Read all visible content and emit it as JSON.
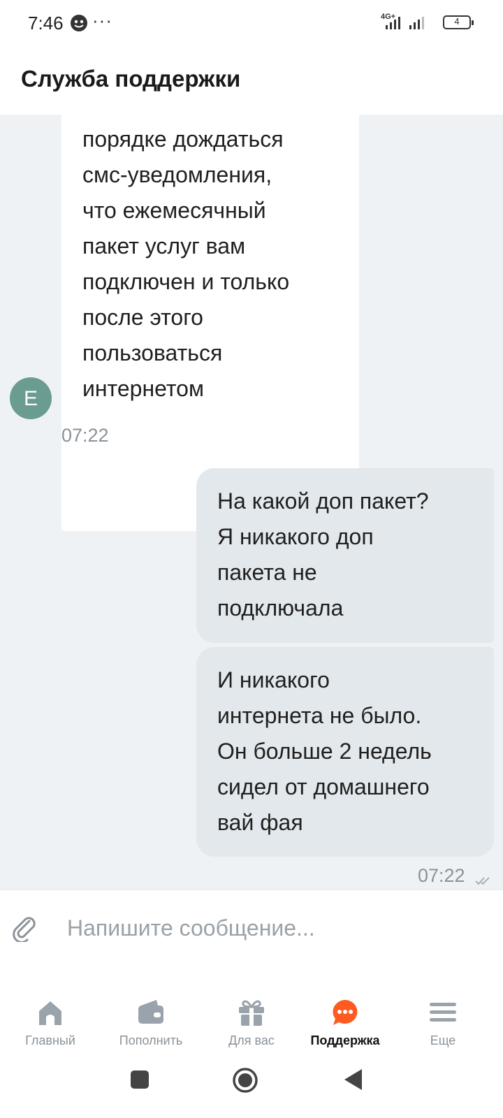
{
  "status_bar": {
    "time": "7:46",
    "overflow": "···",
    "network": "4G+",
    "battery": "4"
  },
  "header": {
    "title": "Служба поддержки"
  },
  "chat": {
    "incoming": {
      "avatar_letter": "E",
      "avatar_color": "#6b9c92",
      "text": "порядке дождаться\nсмс-уведомления,\nчто ежемесячный\nпакет услуг вам\nподключен и только\nпосле этого\nпользоваться\nинтернетом",
      "time": "07:22"
    },
    "outgoing": [
      {
        "text": "На какой доп пакет?\nЯ никакого доп\nпакета не\nподключала"
      },
      {
        "text": "И никакого\nинтернета не было.\nОн больше 2 недель\nсидел от домашнего\nвай фая"
      }
    ],
    "outgoing_time": "07:22",
    "read_status_icon": "double-check-icon"
  },
  "input": {
    "placeholder": "Напишите сообщение..."
  },
  "bottom_nav": {
    "items": [
      {
        "label": "Главный",
        "icon": "home-icon"
      },
      {
        "label": "Пополнить",
        "icon": "wallet-icon"
      },
      {
        "label": "Для вас",
        "icon": "gift-icon"
      },
      {
        "label": "Поддержка",
        "icon": "chat-bubble-icon",
        "active": true
      },
      {
        "label": "Еще",
        "icon": "menu-icon"
      }
    ],
    "accent_color": "#ff5a1f"
  }
}
